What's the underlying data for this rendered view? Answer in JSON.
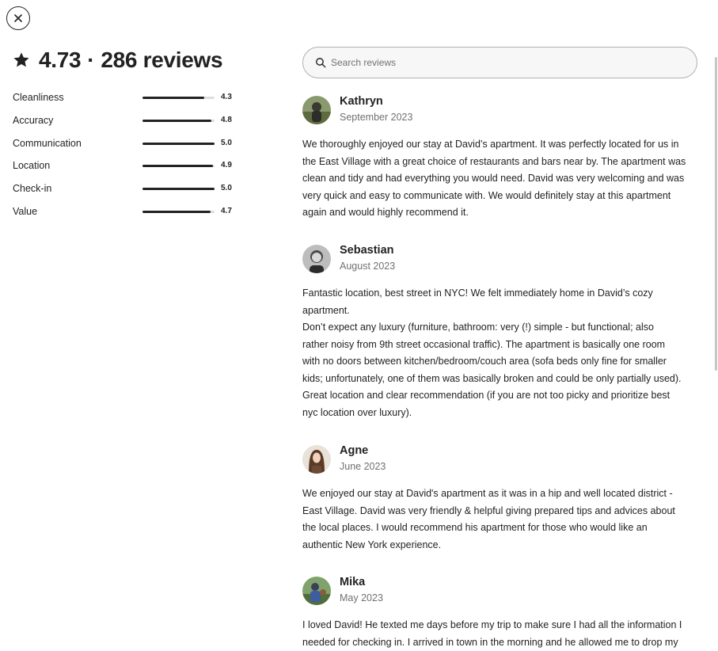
{
  "header": {
    "rating": "4.73",
    "separator": "·",
    "reviews_count": "286 reviews"
  },
  "ratings": [
    {
      "label": "Cleanliness",
      "value": "4.3",
      "score": 4.3
    },
    {
      "label": "Accuracy",
      "value": "4.8",
      "score": 4.8
    },
    {
      "label": "Communication",
      "value": "5.0",
      "score": 5.0
    },
    {
      "label": "Location",
      "value": "4.9",
      "score": 4.9
    },
    {
      "label": "Check-in",
      "value": "5.0",
      "score": 5.0
    },
    {
      "label": "Value",
      "value": "4.7",
      "score": 4.7
    }
  ],
  "search": {
    "placeholder": "Search reviews",
    "value": ""
  },
  "reviews": [
    {
      "name": "Kathryn",
      "date": "September 2023",
      "lines": [
        "We thoroughly enjoyed our stay at David’s apartment. It was perfectly located for us in",
        "the East Village with a great choice of restaurants and bars near by. The apartment was",
        "clean and tidy and had everything you would need. David was very welcoming and was",
        "very quick and easy to communicate with. We would definitely stay at this apartment",
        "again and would highly recommend it."
      ]
    },
    {
      "name": "Sebastian",
      "date": "August 2023",
      "lines": [
        "Fantastic location, best street in NYC! We felt immediately home in David’s cozy",
        "apartment.",
        "Don’t expect any luxury (furniture, bathroom: very (!) simple - but functional; also",
        "rather noisy from 9th street occasional traffic). The apartment is basically one room",
        "with no doors between kitchen/bedroom/couch area (sofa beds only fine for smaller",
        "kids; unfortunately, one of them was basically broken and could be only partially used).",
        "Great location and clear recommendation (if you are not too picky and prioritize best",
        "nyc location over luxury)."
      ]
    },
    {
      "name": "Agne",
      "date": "June 2023",
      "lines": [
        "We enjoyed our stay at David's apartment as it was in a hip and well located district -",
        "East Village. David was very friendly & helpful giving prepared tips and advices about",
        "the local places. I would recommend his apartment for those who would like an",
        "authentic New York experience."
      ]
    },
    {
      "name": "Mika",
      "date": "May 2023",
      "lines": [
        "I loved David! He texted me days before my trip to make sure I had all the information I",
        "needed for checking in. I arrived in town in the morning and he allowed me to drop my"
      ]
    }
  ]
}
